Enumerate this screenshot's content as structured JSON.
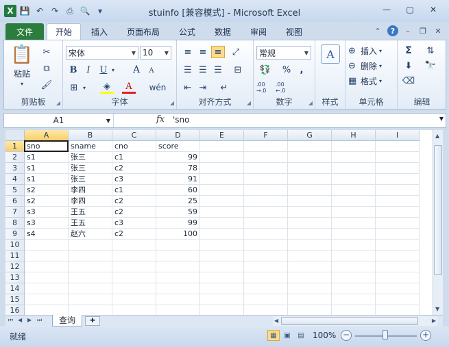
{
  "window": {
    "title": "stuinfo  [兼容模式] - Microsoft Excel",
    "app_icon_label": "X",
    "icons": [
      "save-icon",
      "undo-icon",
      "redo-icon",
      "print-icon",
      "print-preview-icon",
      "customize-qat-icon"
    ]
  },
  "tabs": [
    "文件",
    "开始",
    "插入",
    "页面布局",
    "公式",
    "数据",
    "审阅",
    "视图"
  ],
  "active_tab": "开始",
  "ribbon": {
    "clipboard": {
      "label": "剪贴板",
      "paste": "粘贴"
    },
    "font": {
      "label": "字体",
      "font_name": "宋体",
      "font_size": "10",
      "bold": "B",
      "italic": "I",
      "underline": "U",
      "wen": "wén",
      "grow": "A",
      "shrink": "A"
    },
    "alignment": {
      "label": "对齐方式"
    },
    "number": {
      "label": "数字",
      "format": "常规",
      "percent": "%",
      "comma": ",",
      "dec_inc": ".00 →.0",
      "dec_dec": ".00 ←.0"
    },
    "styles": {
      "label": "样式"
    },
    "cells": {
      "label": "单元格",
      "insert": "插入",
      "delete": "删除",
      "format": "格式"
    },
    "editing": {
      "label": "编辑",
      "sigma": "Σ"
    }
  },
  "formula_bar": {
    "name_box": "A1",
    "fx": "fx",
    "content": "'sno"
  },
  "grid": {
    "columns": [
      "A",
      "B",
      "C",
      "D",
      "E",
      "F",
      "G",
      "H",
      "I"
    ],
    "rows": [
      "1",
      "2",
      "3",
      "4",
      "5",
      "6",
      "7",
      "8",
      "9",
      "10",
      "11",
      "12",
      "13",
      "14",
      "15",
      "16"
    ],
    "headers": [
      "sno",
      "sname",
      "cno",
      "score"
    ],
    "data": [
      [
        "s1",
        "张三",
        "c1",
        "99"
      ],
      [
        "s1",
        "张三",
        "c2",
        "78"
      ],
      [
        "s1",
        "张三",
        "c3",
        "91"
      ],
      [
        "s2",
        "李四",
        "c1",
        "60"
      ],
      [
        "s2",
        "李四",
        "c2",
        "25"
      ],
      [
        "s3",
        "王五",
        "c2",
        "59"
      ],
      [
        "s3",
        "王五",
        "c3",
        "99"
      ],
      [
        "s4",
        "赵六",
        "c2",
        "100"
      ]
    ]
  },
  "sheets": [
    "查询"
  ],
  "status": {
    "ready": "就绪",
    "zoom": "100%"
  },
  "colors": {
    "file_tab": "#2a7d3d",
    "selected_header": "#f8cf6b",
    "accent": "#3a78c4"
  }
}
